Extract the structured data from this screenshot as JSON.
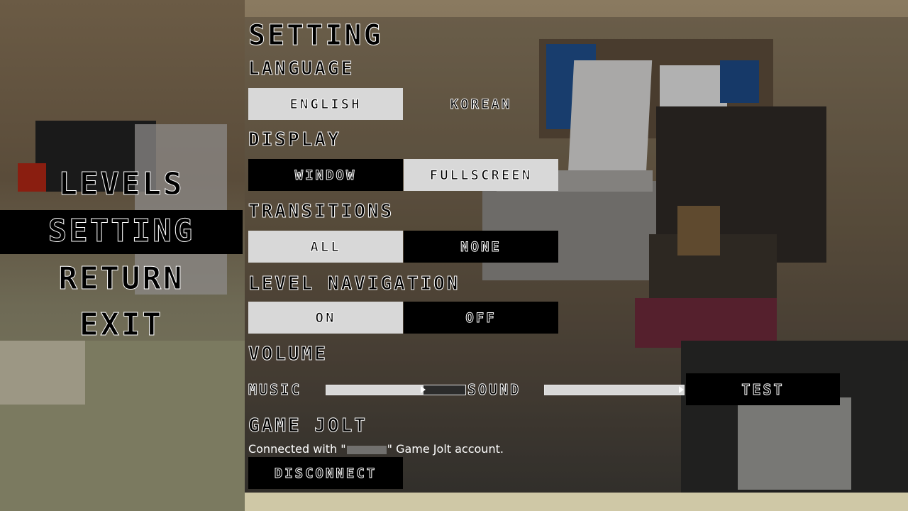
{
  "menu": {
    "levels": "LEVELS",
    "setting": "SETTING",
    "return": "RETURN",
    "exit": "EXIT",
    "selected": "SETTING"
  },
  "settings": {
    "title": "SETTING",
    "language": {
      "heading": "LANGUAGE",
      "options": [
        "ENGLISH",
        "KOREAN"
      ],
      "selected": "ENGLISH"
    },
    "display": {
      "heading": "DISPLAY",
      "options": [
        "WINDOW",
        "FULLSCREEN"
      ],
      "selected": "FULLSCREEN"
    },
    "transitions": {
      "heading": "TRANSITIONS",
      "options": [
        "ALL",
        "NONE"
      ],
      "selected": "ALL"
    },
    "level_navigation": {
      "heading": "LEVEL NAVIGATION",
      "options": [
        "ON",
        "OFF"
      ],
      "selected": "ON"
    },
    "volume": {
      "heading": "VOLUME",
      "music_label": "MUSIC",
      "music_level": 0.7,
      "sound_label": "SOUND",
      "sound_level": 1.0,
      "test_label": "TEST"
    },
    "game_jolt": {
      "heading": "GAME JOLT",
      "status_prefix": "Connected with \"",
      "status_suffix": "\" Game Jolt account.",
      "disconnect_label": "DISCONNECT"
    }
  },
  "colors": {
    "selected_bg": "#d8d8d8",
    "unselected_bg": "#000000",
    "text_fill": "#000000",
    "text_outline": "#ffffff"
  }
}
